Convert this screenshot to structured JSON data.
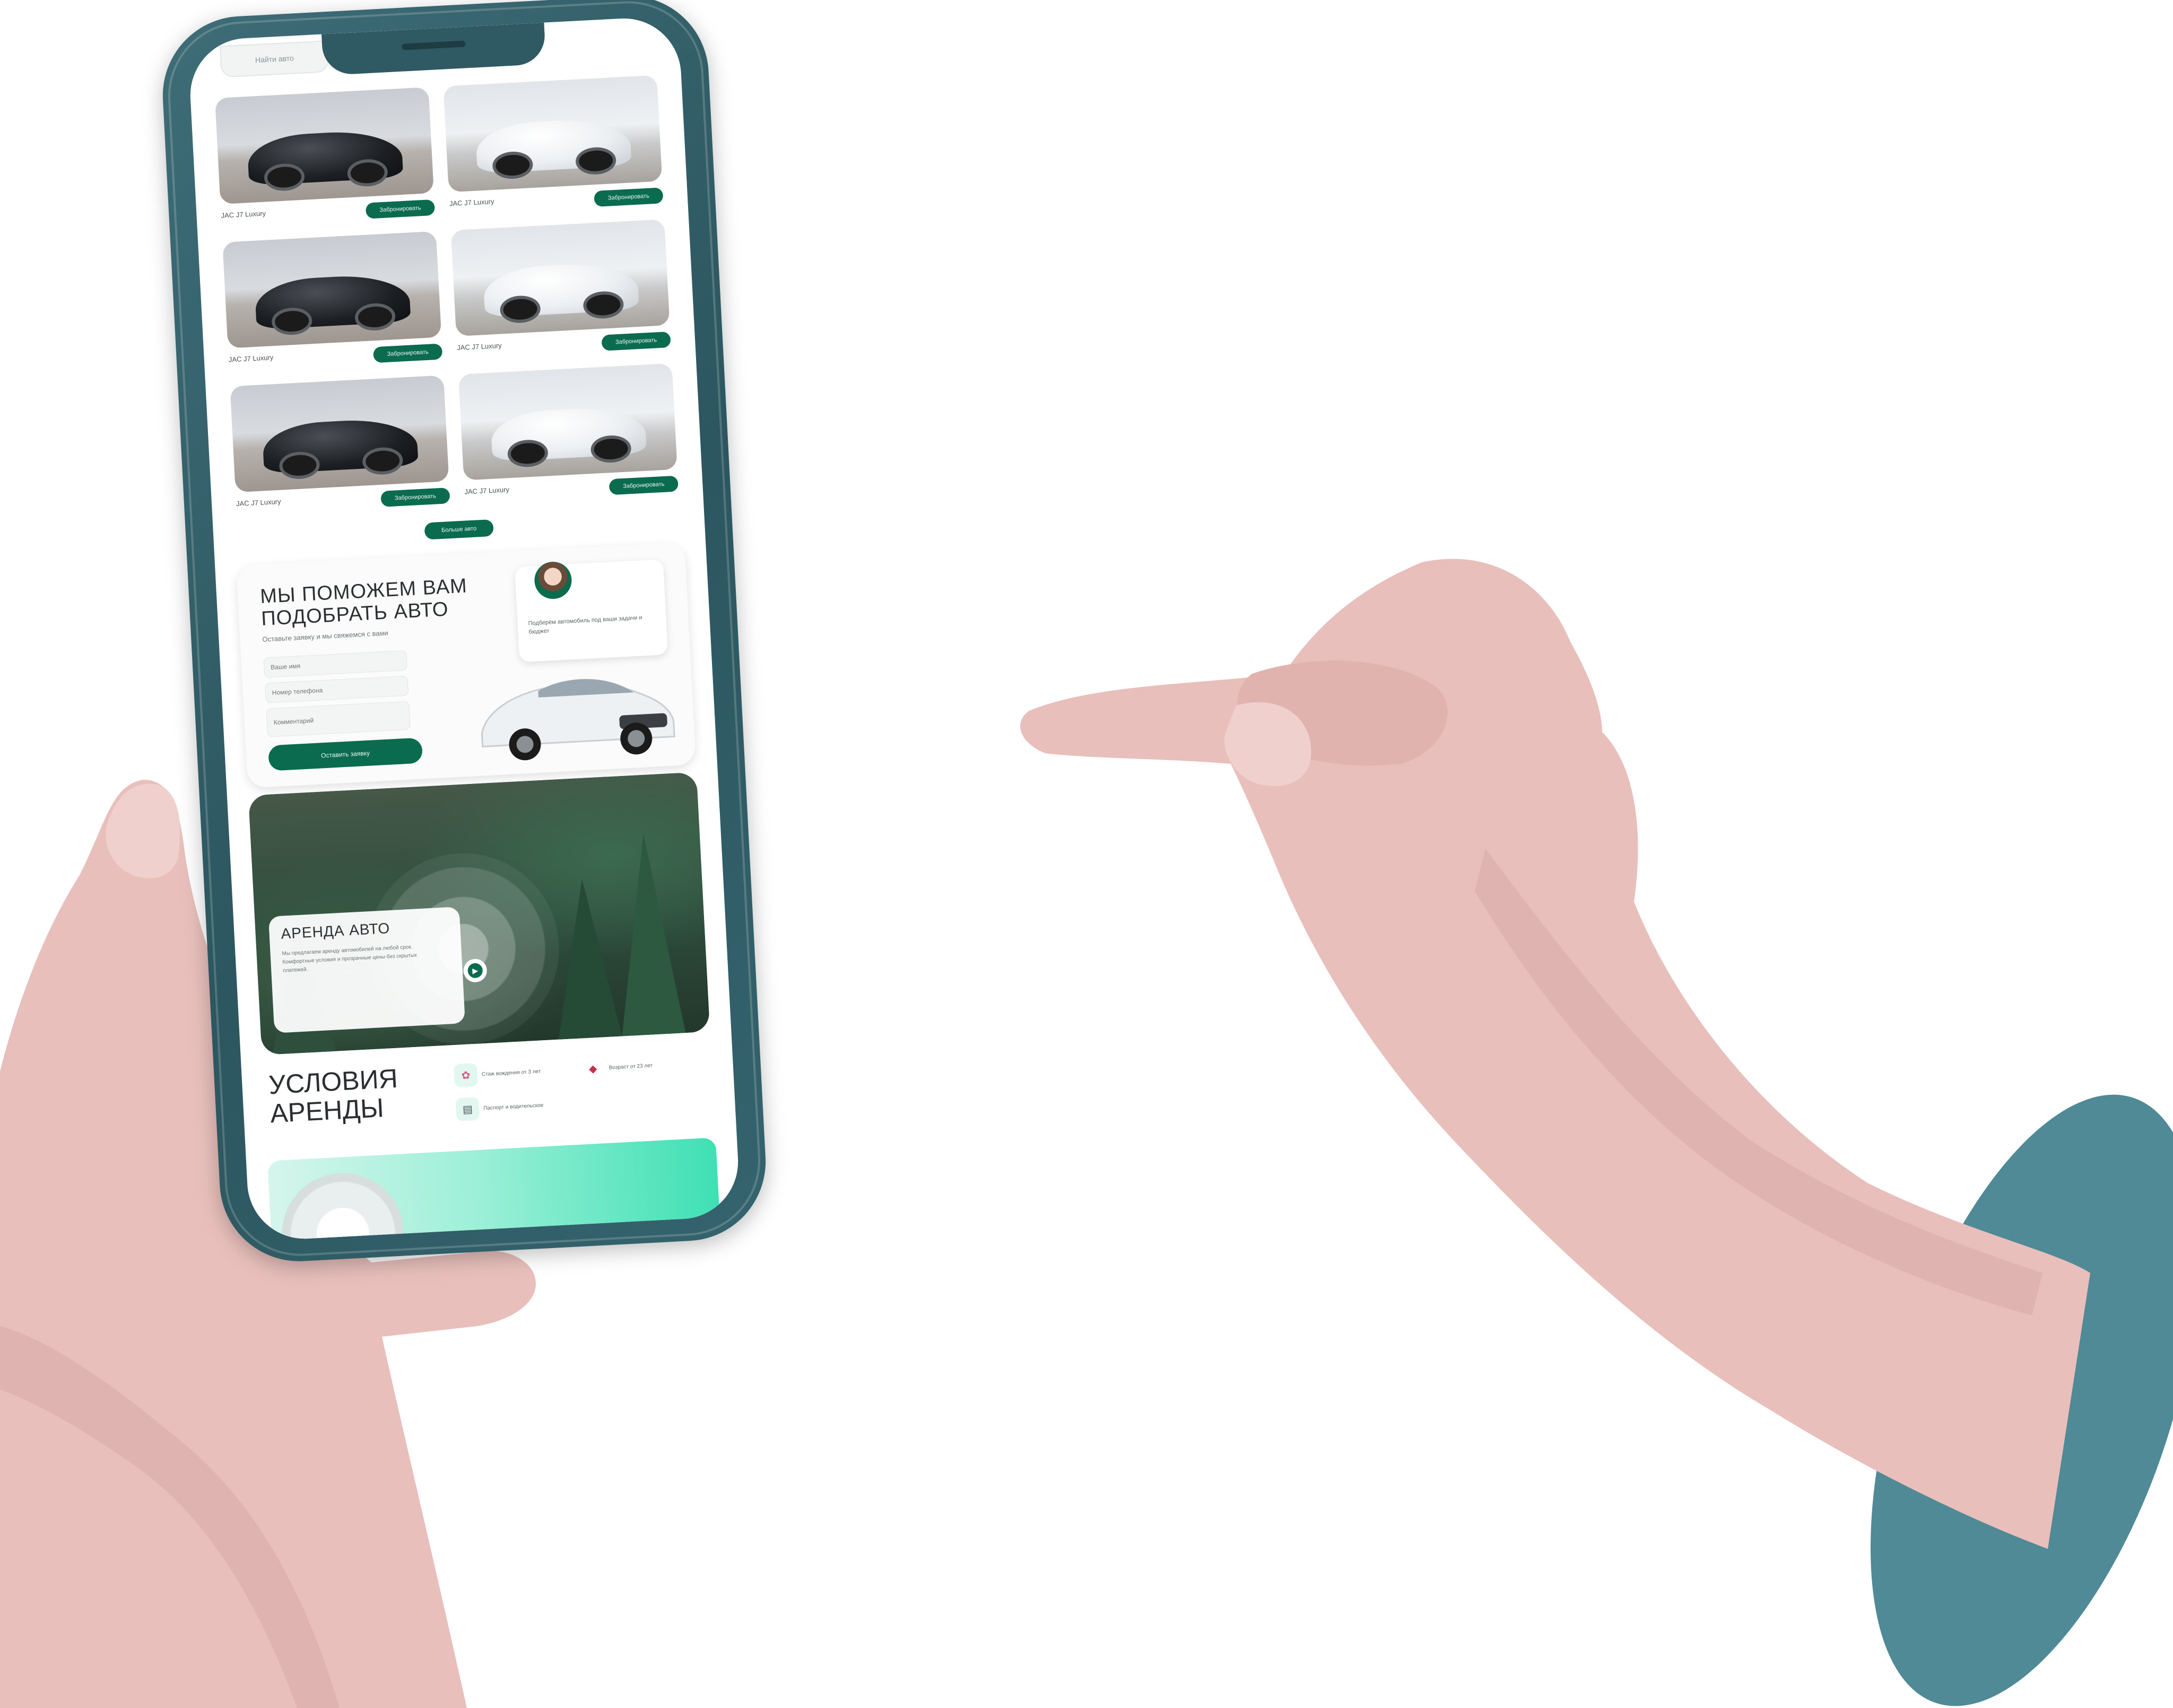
{
  "colors": {
    "phone_frame": "#2f5a63",
    "accent_green": "#0b6b4e",
    "skin": "#e8bfbb",
    "skin_shadow": "#d5a7a3",
    "teal_disc": "#4f8a96",
    "mint": "#3fe0b4"
  },
  "header": {
    "search_placeholder": "Найти авто"
  },
  "cars": [
    {
      "variant": "dark",
      "name": "JAC J7 Luxury",
      "button": "Забронировать"
    },
    {
      "variant": "white",
      "name": "JAC J7 Luxury",
      "button": "Забронировать"
    },
    {
      "variant": "dark",
      "name": "JAC J7 Luxury",
      "button": "Забронировать"
    },
    {
      "variant": "white",
      "name": "JAC J7 Luxury",
      "button": "Забронировать"
    },
    {
      "variant": "dark",
      "name": "JAC J7 Luxury",
      "button": "Забронировать"
    },
    {
      "variant": "white",
      "name": "JAC J7 Luxury",
      "button": "Забронировать"
    }
  ],
  "more_button": "Больше авто",
  "help_form": {
    "title": "МЫ ПОМОЖЕМ ВАМ ПОДОБРАТЬ АВТО",
    "subtitle": "Оставьте заявку и мы свяжемся с вами",
    "name_placeholder": "Ваше имя",
    "phone_placeholder": "Номер телефона",
    "comment_placeholder": "Комментарий",
    "submit": "Оставить заявку",
    "consultant_text": "Подберём автомобиль под ваши задачи и бюджет"
  },
  "rent_banner": {
    "title": "АРЕНДА АВТО",
    "text": "Мы предлагаем аренду автомобилей на любой срок. Комфортные условия и прозрачные цены без скрытых платежей."
  },
  "conditions": {
    "title": "УСЛОВИЯ АРЕНДЫ",
    "items": [
      {
        "icon": "license-icon",
        "label": "Стаж вождения от 3 лет"
      },
      {
        "icon": "wallet-icon",
        "label": "Возраст от 23 лет"
      },
      {
        "icon": "document-icon",
        "label": "Паспорт и водительское"
      }
    ]
  }
}
